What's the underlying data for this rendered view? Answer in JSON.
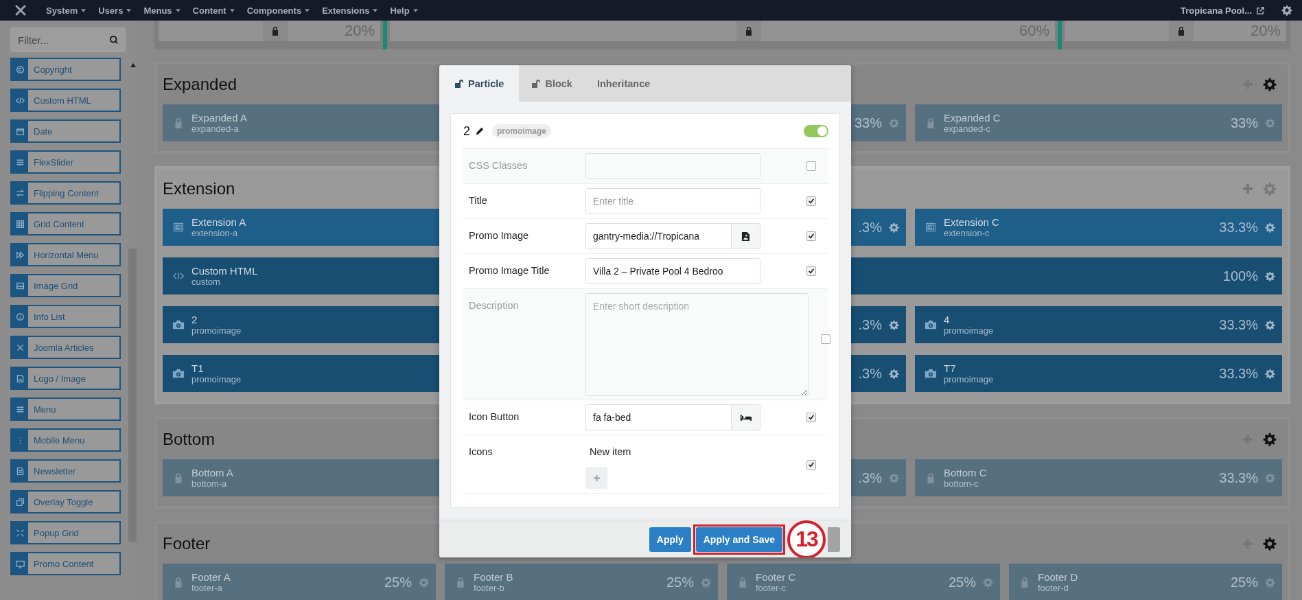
{
  "top_bar": {
    "menus": [
      {
        "label": "System"
      },
      {
        "label": "Users"
      },
      {
        "label": "Menus"
      },
      {
        "label": "Content"
      },
      {
        "label": "Components"
      },
      {
        "label": "Extensions"
      },
      {
        "label": "Help"
      }
    ],
    "site_link": "Tropicana Pool..."
  },
  "sidebar": {
    "filter": {
      "placeholder": "Filter..."
    },
    "items": [
      {
        "label": "Copyright"
      },
      {
        "label": "Custom HTML"
      },
      {
        "label": "Date"
      },
      {
        "label": "FlexSlider"
      },
      {
        "label": "Flipping Content"
      },
      {
        "label": "Grid Content"
      },
      {
        "label": "Horizontal Menu"
      },
      {
        "label": "Image Grid"
      },
      {
        "label": "Info List"
      },
      {
        "label": "Joomla Articles"
      },
      {
        "label": "Logo / Image"
      },
      {
        "label": "Menu"
      },
      {
        "label": "Mobile Menu"
      },
      {
        "label": "Newsletter"
      },
      {
        "label": "Overlay Toggle"
      },
      {
        "label": "Popup Grid"
      },
      {
        "label": "Promo Content"
      }
    ]
  },
  "layout_strip": [
    {
      "percent": "20%"
    },
    {
      "percent": "60%"
    },
    {
      "percent": "20%"
    }
  ],
  "sections": [
    {
      "title": "Expanded",
      "locked": true,
      "rows": [
        [
          {
            "kind": "locked",
            "title": "Expanded A",
            "subtitle": "expanded-a"
          },
          {
            "kind": "locked",
            "percent": "33%"
          },
          {
            "kind": "locked",
            "title": "Expanded C",
            "subtitle": "expanded-c",
            "percent": "33%"
          }
        ]
      ]
    },
    {
      "title": "Extension",
      "locked": false,
      "rows": [
        [
          {
            "kind": "module",
            "title": "Extension A",
            "subtitle": "extension-a"
          },
          {
            "kind": "module",
            "percent": ".3%"
          },
          {
            "kind": "module",
            "title": "Extension C",
            "subtitle": "extension-c",
            "percent": "33.3%"
          }
        ],
        [
          {
            "kind": "html",
            "title": "Custom HTML",
            "subtitle": "custom",
            "percent": "100%"
          }
        ],
        [
          {
            "kind": "image",
            "title": "2",
            "subtitle": "promoimage"
          },
          {
            "kind": "image",
            "percent": ".3%"
          },
          {
            "kind": "image",
            "title": "4",
            "subtitle": "promoimage",
            "percent": "33.3%"
          }
        ],
        [
          {
            "kind": "image",
            "title": "T1",
            "subtitle": "promoimage"
          },
          {
            "kind": "image",
            "percent": ".3%"
          },
          {
            "kind": "image",
            "title": "T7",
            "subtitle": "promoimage",
            "percent": "33.3%"
          }
        ]
      ]
    },
    {
      "title": "Bottom",
      "locked": true,
      "rows": [
        [
          {
            "kind": "locked",
            "title": "Bottom A",
            "subtitle": "bottom-a"
          },
          {
            "kind": "locked",
            "percent": ".3%"
          },
          {
            "kind": "locked",
            "title": "Bottom C",
            "subtitle": "bottom-c",
            "percent": "33.3%"
          }
        ]
      ]
    },
    {
      "title": "Footer",
      "locked": true,
      "rows": [
        [
          {
            "kind": "locked",
            "title": "Footer A",
            "subtitle": "footer-a",
            "percent": "25%"
          },
          {
            "kind": "locked",
            "title": "Footer B",
            "subtitle": "footer-b",
            "percent": "25%"
          },
          {
            "kind": "locked",
            "title": "Footer C",
            "subtitle": "footer-c",
            "percent": "25%"
          },
          {
            "kind": "locked",
            "title": "Footer D",
            "subtitle": "footer-d",
            "percent": "25%"
          }
        ]
      ]
    }
  ],
  "modal": {
    "tabs": [
      {
        "label": "Particle",
        "selected": true,
        "kind": "lock"
      },
      {
        "label": "Block",
        "selected": false,
        "kind": "lock"
      },
      {
        "label": "Inheritance",
        "selected": false,
        "kind": "plain"
      }
    ],
    "particle": {
      "name": "2",
      "type": "promoimage",
      "enabled": true
    },
    "fields": [
      {
        "label": "CSS Classes",
        "kind": "text",
        "checked": false
      },
      {
        "label": "Title",
        "kind": "text",
        "placeholder": "Enter title",
        "checked": true
      },
      {
        "label": "Promo Image",
        "kind": "image_picker",
        "value": "gantry-media://Tropicana",
        "checked": true
      },
      {
        "label": "Promo Image Title",
        "kind": "text",
        "value": "Villa 2 – Private Pool 4 Bedroo",
        "checked": true
      },
      {
        "label": "Description",
        "kind": "textarea",
        "placeholder": "Enter short description",
        "checked": false
      },
      {
        "label": "Icon Button",
        "kind": "icon_picker",
        "value": "fa fa-bed",
        "checked": true
      },
      {
        "label": "Icons",
        "kind": "list",
        "items": [
          "New item"
        ],
        "checked": true
      }
    ],
    "buttons": [
      {
        "kind": "primary",
        "label": "Apply",
        "highlighted": false
      },
      {
        "kind": "primary",
        "label": "Apply and Save",
        "highlighted": true
      },
      {
        "kind": "secondary",
        "highlighted": false
      }
    ],
    "annotation": {
      "number": "13"
    }
  }
}
